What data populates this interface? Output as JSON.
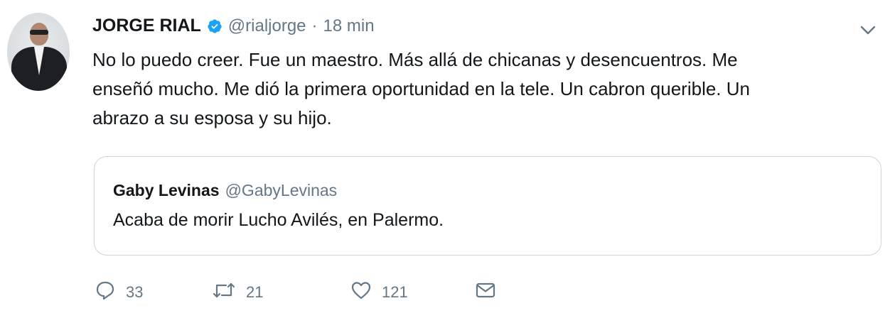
{
  "tweet": {
    "author_name": "JORGE RIAL",
    "handle": "@rialjorge",
    "separator": "·",
    "time": "18 min",
    "text": "No lo puedo creer. Fue un maestro. Más allá de chicanas y desencuentros. Me\nenseñó mucho. Me dió la primera oportunidad en la tele. Un cabron querible. Un\nabrazo a su esposa y su hijo."
  },
  "quoted": {
    "author_name": "Gaby Levinas",
    "handle": "@GabyLevinas",
    "text": "Acaba de morir Lucho Avilés, en Palermo."
  },
  "actions": {
    "replies": "33",
    "retweets": "21",
    "likes": "121"
  },
  "icons": {
    "verified": "verified-badge-icon",
    "menu": "chevron-down-icon",
    "reply": "reply-icon",
    "retweet": "retweet-icon",
    "like": "heart-icon",
    "dm": "envelope-icon"
  },
  "colors": {
    "text": "#14171a",
    "secondary": "#657786",
    "verified": "#1da1f2",
    "border": "#ccd6dd"
  }
}
